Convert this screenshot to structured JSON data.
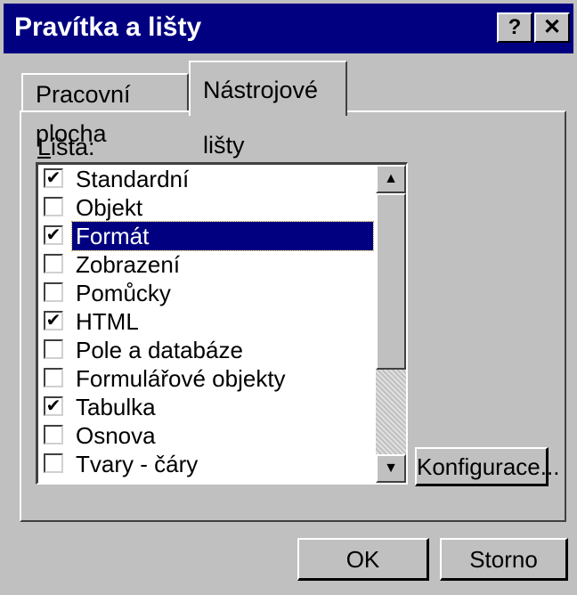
{
  "window": {
    "title": "Pravítka a lišty",
    "help_button": "?",
    "close_button": "✕"
  },
  "tabs": [
    {
      "label": "Pracovní plocha",
      "active": false
    },
    {
      "label": "Nástrojové lišty",
      "active": true
    }
  ],
  "list": {
    "label_prefix": "L",
    "label_rest": "išta:",
    "items": [
      {
        "label": "Standardní",
        "checked": true,
        "check": "✔"
      },
      {
        "label": "Objekt",
        "checked": false,
        "check": ""
      },
      {
        "label": "Formát",
        "checked": true,
        "check": "✔",
        "selected": true
      },
      {
        "label": "Zobrazení",
        "checked": false,
        "check": ""
      },
      {
        "label": "Pomůcky",
        "checked": false,
        "check": ""
      },
      {
        "label": "HTML",
        "checked": true,
        "check": "✔"
      },
      {
        "label": "Pole a databáze",
        "checked": false,
        "check": ""
      },
      {
        "label": "Formulářové objekty",
        "checked": false,
        "check": ""
      },
      {
        "label": "Tabulka",
        "checked": true,
        "check": "✔"
      },
      {
        "label": "Osnova",
        "checked": false,
        "check": ""
      },
      {
        "label": "Tvary - čáry",
        "checked": false,
        "check": ""
      }
    ],
    "scroll_up": "▲",
    "scroll_down": "▼"
  },
  "buttons": {
    "configure": "Konfigurace...",
    "ok": "OK",
    "cancel": "Storno"
  }
}
